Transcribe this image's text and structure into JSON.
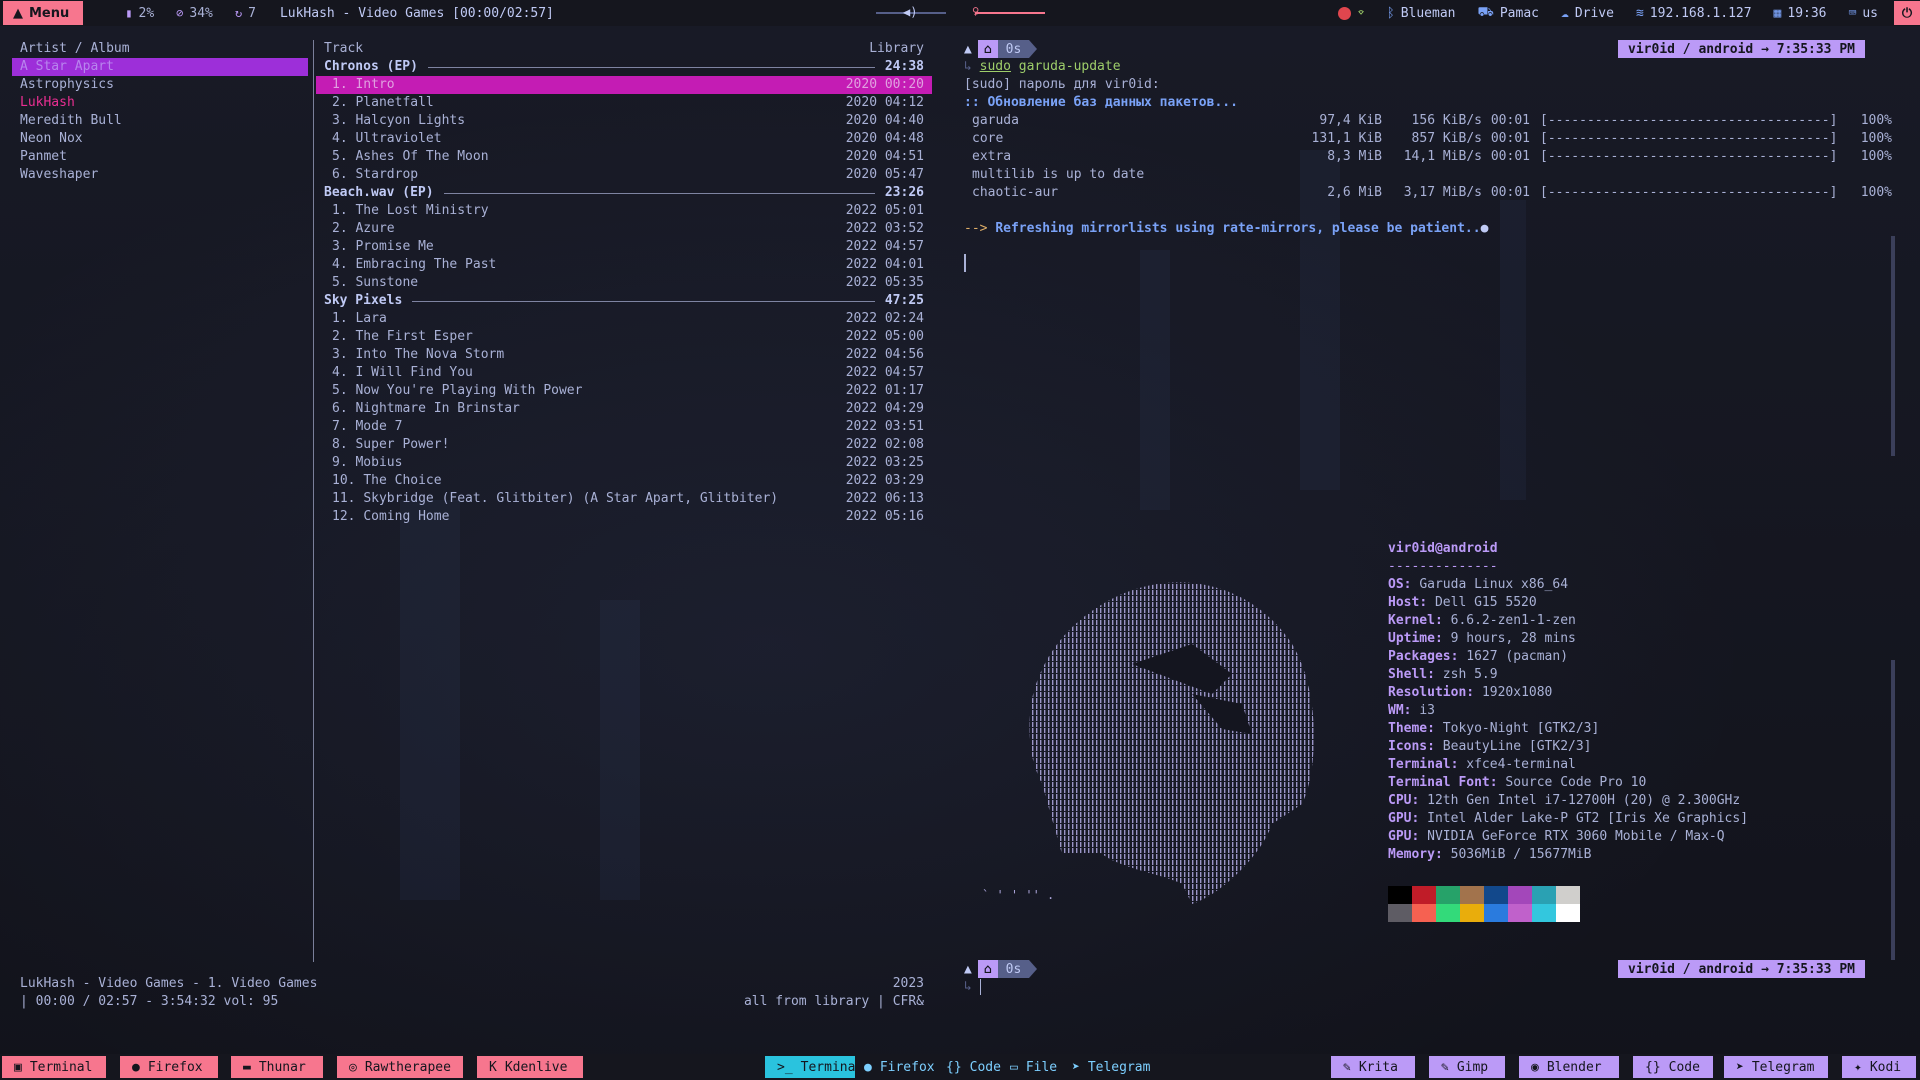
{
  "topbar": {
    "menu_label": "Menu",
    "mem": "2%",
    "disk": "34%",
    "updates": "7",
    "window_title": "LukHash - Video Games [00:00/02:57]",
    "bluetooth": "Blueman",
    "pamac": "Pamac",
    "drive": "Drive",
    "ip": "192.168.1.127",
    "clock": "19:36",
    "keyboard": "us"
  },
  "cmus": {
    "artist_header": "Artist / Album",
    "artists": [
      "A Star Apart",
      "Astrophysics",
      "LukHash",
      "Meredith Bull",
      "Neon Nox",
      "Panmet",
      "Waveshaper"
    ],
    "track_header": "Track",
    "library_header": "Library",
    "albums": [
      {
        "name": "Chronos (EP)",
        "total": "24:38",
        "tracks": [
          {
            "n": "1.",
            "title": "Intro",
            "year": "2020",
            "len": "00:20"
          },
          {
            "n": "2.",
            "title": "Planetfall",
            "year": "2020",
            "len": "04:12"
          },
          {
            "n": "3.",
            "title": "Halcyon Lights",
            "year": "2020",
            "len": "04:40"
          },
          {
            "n": "4.",
            "title": "Ultraviolet",
            "year": "2020",
            "len": "04:48"
          },
          {
            "n": "5.",
            "title": "Ashes Of The Moon",
            "year": "2020",
            "len": "04:51"
          },
          {
            "n": "6.",
            "title": "Stardrop",
            "year": "2020",
            "len": "05:47"
          }
        ]
      },
      {
        "name": "Beach.wav (EP)",
        "total": "23:26",
        "tracks": [
          {
            "n": "1.",
            "title": "The Lost Ministry",
            "year": "2022",
            "len": "05:01"
          },
          {
            "n": "2.",
            "title": "Azure",
            "year": "2022",
            "len": "03:52"
          },
          {
            "n": "3.",
            "title": "Promise Me",
            "year": "2022",
            "len": "04:57"
          },
          {
            "n": "4.",
            "title": "Embracing The Past",
            "year": "2022",
            "len": "04:01"
          },
          {
            "n": "5.",
            "title": "Sunstone",
            "year": "2022",
            "len": "05:35"
          }
        ]
      },
      {
        "name": "Sky Pixels",
        "total": "47:25",
        "tracks": [
          {
            "n": "1.",
            "title": "Lara",
            "year": "2022",
            "len": "02:24"
          },
          {
            "n": "2.",
            "title": "The First Esper",
            "year": "2022",
            "len": "05:00"
          },
          {
            "n": "3.",
            "title": "Into The Nova Storm",
            "year": "2022",
            "len": "04:56"
          },
          {
            "n": "4.",
            "title": "I Will Find You",
            "year": "2022",
            "len": "04:57"
          },
          {
            "n": "5.",
            "title": "Now You're Playing With Power",
            "year": "2022",
            "len": "01:17"
          },
          {
            "n": "6.",
            "title": "Nightmare In Brinstar",
            "year": "2022",
            "len": "04:29"
          },
          {
            "n": "7.",
            "title": "Mode 7",
            "year": "2022",
            "len": "03:51"
          },
          {
            "n": "8.",
            "title": "Super Power!",
            "year": "2022",
            "len": "02:08"
          },
          {
            "n": "9.",
            "title": "Mobius",
            "year": "2022",
            "len": "03:25"
          },
          {
            "n": "10.",
            "title": "The Choice",
            "year": "2022",
            "len": "03:29"
          },
          {
            "n": "11.",
            "title": "Skybridge (Feat. Glitbiter) (A Star Apart, Glitbiter)",
            "year": "2022",
            "len": "06:13"
          },
          {
            "n": "12.",
            "title": "Coming Home",
            "year": "2022",
            "len": "05:16"
          }
        ]
      }
    ],
    "status_left_1": "LukHash - Video Games - 1. Video Games",
    "status_right_1": "2023",
    "status_left_2": "| 00:00 / 02:57 - 3:54:32 vol: 95",
    "status_right_2": "all from library | CFR&"
  },
  "term1": {
    "prompt_dir": "0s",
    "right_prompt": "vir0id / android → 7:35:33 PM",
    "cmd_sudo": "sudo",
    "cmd_rest": " garuda-update",
    "line_sudo": "[sudo] пароль для vir0id:",
    "line_sync": ":: Обновление баз данных пакетов...",
    "downloads": [
      {
        "name": "garuda",
        "size": "97,4 KiB",
        "rate": "156 KiB/s",
        "time": "00:01",
        "bar": "[------------------------------------]",
        "pct": "100%"
      },
      {
        "name": "core",
        "size": "131,1 KiB",
        "rate": "857 KiB/s",
        "time": "00:01",
        "bar": "[------------------------------------]",
        "pct": "100%"
      },
      {
        "name": "extra",
        "size": "8,3 MiB",
        "rate": "14,1 MiB/s",
        "time": "00:01",
        "bar": "[------------------------------------]",
        "pct": "100%"
      }
    ],
    "multilib": "multilib is up to date",
    "chaotic": {
      "name": "chaotic-aur",
      "size": "2,6 MiB",
      "rate": "3,17 MiB/s",
      "time": "00:01",
      "bar": "[------------------------------------]",
      "pct": "100%"
    },
    "arrow": "-->",
    "refresh_msg": "Refreshing mirrorlists using rate-mirrors, please be patient..",
    "refresh_icon": "●"
  },
  "term2": {
    "user_host": "vir0id@android",
    "separator": "--------------",
    "info": [
      {
        "key": "OS",
        "value": "Garuda Linux x86_64"
      },
      {
        "key": "Host",
        "value": "Dell G15 5520"
      },
      {
        "key": "Kernel",
        "value": "6.6.2-zen1-1-zen"
      },
      {
        "key": "Uptime",
        "value": "9 hours, 28 mins"
      },
      {
        "key": "Packages",
        "value": "1627 (pacman)"
      },
      {
        "key": "Shell",
        "value": "zsh 5.9"
      },
      {
        "key": "Resolution",
        "value": "1920x1080"
      },
      {
        "key": "WM",
        "value": "i3"
      },
      {
        "key": "Theme",
        "value": "Tokyo-Night [GTK2/3]"
      },
      {
        "key": "Icons",
        "value": "BeautyLine [GTK2/3]"
      },
      {
        "key": "Terminal",
        "value": "xfce4-terminal"
      },
      {
        "key": "Terminal Font",
        "value": "Source Code Pro 10"
      },
      {
        "key": "CPU",
        "value": "12th Gen Intel i7-12700H (20) @ 2.300GHz"
      },
      {
        "key": "GPU",
        "value": "Intel Alder Lake-P GT2 [Iris Xe Graphics]"
      },
      {
        "key": "GPU",
        "value": "NVIDIA GeForce RTX 3060 Mobile / Max-Q"
      },
      {
        "key": "Memory",
        "value": "5036MiB / 15677MiB"
      }
    ],
    "palette_top": [
      "#000000",
      "#c01c28",
      "#26a269",
      "#a2734c",
      "#12488b",
      "#a347ba",
      "#2aa1b3",
      "#d0cfcc"
    ],
    "palette_bottom": [
      "#5e5c64",
      "#f66151",
      "#33da7a",
      "#e9ad0c",
      "#2a7bde",
      "#c061cb",
      "#33c7de",
      "#ffffff"
    ],
    "prompt_dir": "0s",
    "right_prompt": "vir0id / android → 7:35:33 PM"
  },
  "taskbar": {
    "left": [
      "Terminal",
      "Firefox",
      "Thunar",
      "Rawtherapee",
      "Kdenlive"
    ],
    "center_active": "Terminal",
    "center": [
      "Firefox",
      "Code",
      "File",
      "Telegram"
    ],
    "right": [
      "Krita",
      "Gimp",
      "Blender",
      "Code",
      "Telegram",
      "Kodi"
    ]
  },
  "colors": {
    "accent": "#bb9af7",
    "red": "#f7768e",
    "selection_magenta": "#c41cb4",
    "selection_purple": "#9d2fd9",
    "background": "#14151f"
  }
}
